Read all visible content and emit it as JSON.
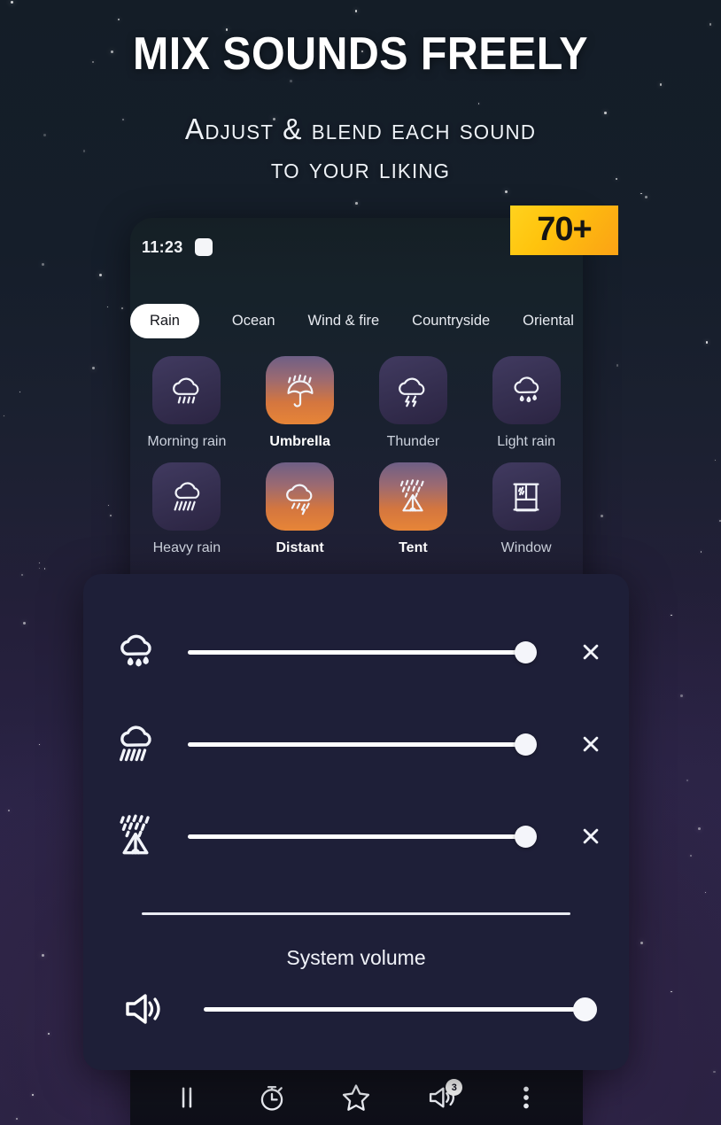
{
  "hero": {
    "headline": "MIX SOUNDS FREELY",
    "subtitle_line1": "Adjust & blend each sound",
    "subtitle_line2": "to your liking"
  },
  "badge": {
    "label": "70+",
    "color": "#ffc30d"
  },
  "phone": {
    "status_bar": {
      "time": "11:23",
      "notification_icon": "rounded-square-icon"
    },
    "tabs": [
      {
        "label": "Rain",
        "active": true
      },
      {
        "label": "Ocean",
        "active": false
      },
      {
        "label": "Wind & fire",
        "active": false
      },
      {
        "label": "Countryside",
        "active": false
      },
      {
        "label": "Oriental",
        "active": false
      }
    ],
    "sounds": [
      {
        "label": "Morning rain",
        "icon": "cloud-rain-icon",
        "active": false
      },
      {
        "label": "Umbrella",
        "icon": "umbrella-rain-icon",
        "active": true
      },
      {
        "label": "Thunder",
        "icon": "cloud-lightning-icon",
        "active": false
      },
      {
        "label": "Light rain",
        "icon": "cloud-drops-icon",
        "active": false
      },
      {
        "label": "Heavy rain",
        "icon": "cloud-heavy-rain-icon",
        "active": false
      },
      {
        "label": "Distant",
        "icon": "cloud-storm-icon",
        "active": true
      },
      {
        "label": "Tent",
        "icon": "tent-rain-icon",
        "active": true
      },
      {
        "label": "Window",
        "icon": "window-rain-icon",
        "active": false
      }
    ],
    "bottom_nav": [
      {
        "name": "pause",
        "icon": "pause-icon",
        "badge": null
      },
      {
        "name": "timer",
        "icon": "timer-icon",
        "badge": null
      },
      {
        "name": "favorites",
        "icon": "star-icon",
        "badge": null
      },
      {
        "name": "volume",
        "icon": "volume-icon",
        "badge": "3"
      },
      {
        "name": "more",
        "icon": "more-vertical-icon",
        "badge": null
      }
    ]
  },
  "mixer": {
    "accent_color": "#ffffff",
    "panel_color": "#1e1f38",
    "sliders": [
      {
        "icon": "cloud-drops-icon",
        "value": 95,
        "close_label": "✕"
      },
      {
        "icon": "cloud-heavy-rain-icon",
        "value": 95,
        "close_label": "✕"
      },
      {
        "icon": "tent-rain-icon",
        "value": 95,
        "close_label": "✕"
      }
    ],
    "system_volume": {
      "label": "System volume",
      "icon": "speaker-icon",
      "value": 100
    }
  }
}
